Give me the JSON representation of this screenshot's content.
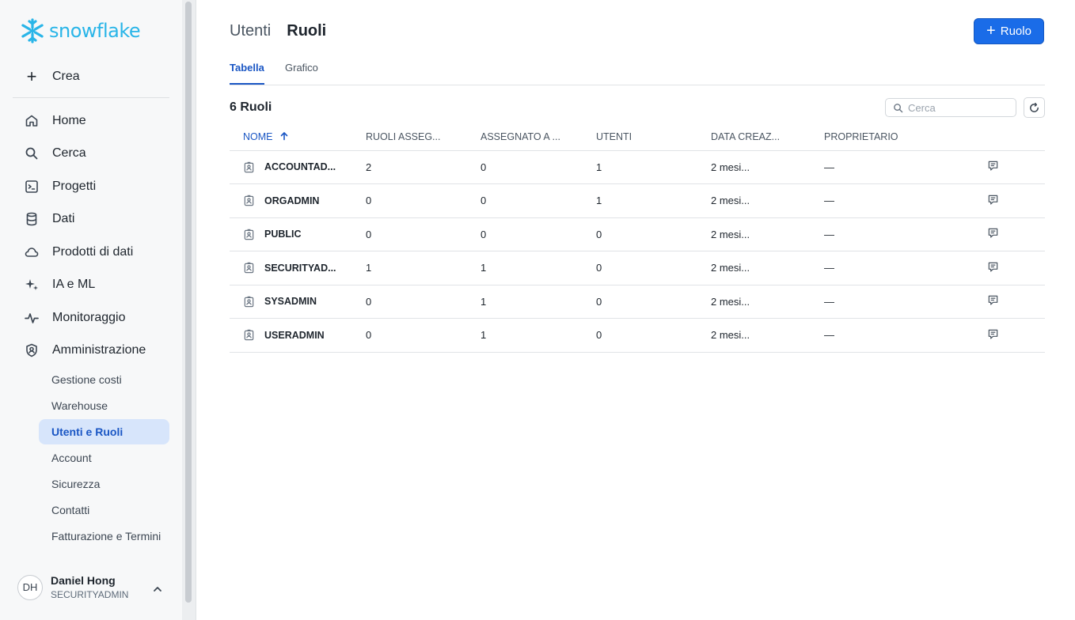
{
  "app": {
    "logo_text": "snowflake",
    "brand_color": "#29b5e8",
    "accent_color": "#1a6ce8"
  },
  "sidebar": {
    "create_label": "Crea",
    "nav": [
      {
        "label": "Home",
        "icon": "home-icon"
      },
      {
        "label": "Cerca",
        "icon": "search-icon"
      },
      {
        "label": "Progetti",
        "icon": "projects-icon"
      },
      {
        "label": "Dati",
        "icon": "database-icon"
      },
      {
        "label": "Prodotti di dati",
        "icon": "cloud-icon"
      },
      {
        "label": "IA e ML",
        "icon": "sparkle-icon"
      },
      {
        "label": "Monitoraggio",
        "icon": "activity-icon"
      },
      {
        "label": "Amministrazione",
        "icon": "shield-icon"
      }
    ],
    "admin_items": [
      {
        "label": "Gestione costi"
      },
      {
        "label": "Warehouse"
      },
      {
        "label": "Utenti e Ruoli",
        "active": true
      },
      {
        "label": "Account"
      },
      {
        "label": "Sicurezza"
      },
      {
        "label": "Contatti"
      },
      {
        "label": "Fatturazione e Termini"
      }
    ],
    "user": {
      "initials": "DH",
      "name": "Daniel Hong",
      "role": "SECURITYADMIN"
    }
  },
  "header": {
    "breadcrumb_parent": "Utenti",
    "breadcrumb_current": "Ruoli",
    "add_button_label": "Ruolo"
  },
  "tabs": [
    {
      "label": "Tabella",
      "active": true
    },
    {
      "label": "Grafico",
      "active": false
    }
  ],
  "table": {
    "count_label": "6 Ruoli",
    "search_placeholder": "Cerca",
    "columns": [
      "NOME",
      "RUOLI ASSEG...",
      "ASSEGNATO A ...",
      "UTENTI",
      "DATA CREAZ...",
      "PROPRIETARIO"
    ],
    "rows": [
      {
        "name": "ACCOUNTAD...",
        "roles_assigned": "2",
        "assigned_to": "0",
        "users": "1",
        "created": "2 mesi...",
        "owner": "—"
      },
      {
        "name": "ORGADMIN",
        "roles_assigned": "0",
        "assigned_to": "0",
        "users": "1",
        "created": "2 mesi...",
        "owner": "—"
      },
      {
        "name": "PUBLIC",
        "roles_assigned": "0",
        "assigned_to": "0",
        "users": "0",
        "created": "2 mesi...",
        "owner": "—"
      },
      {
        "name": "SECURITYAD...",
        "roles_assigned": "1",
        "assigned_to": "1",
        "users": "0",
        "created": "2 mesi...",
        "owner": "—"
      },
      {
        "name": "SYSADMIN",
        "roles_assigned": "0",
        "assigned_to": "1",
        "users": "0",
        "created": "2 mesi...",
        "owner": "—"
      },
      {
        "name": "USERADMIN",
        "roles_assigned": "0",
        "assigned_to": "1",
        "users": "0",
        "created": "2 mesi...",
        "owner": "—"
      }
    ]
  }
}
